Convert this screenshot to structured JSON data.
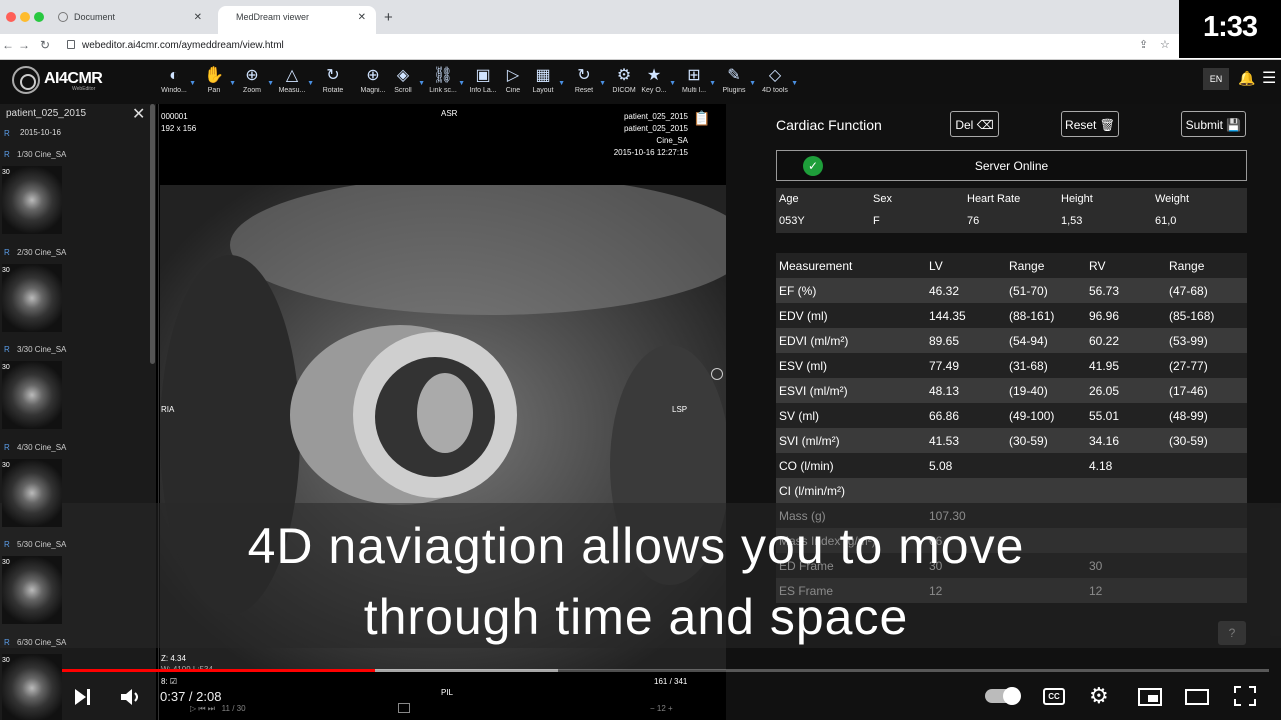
{
  "browser": {
    "tabs": [
      {
        "label": "Document"
      },
      {
        "label": "MedDream viewer"
      }
    ],
    "url": "webeditor.ai4cmr.com/aymeddream/view.html"
  },
  "video_time_overlay": "1:33",
  "app": {
    "brand": "AI4CMR",
    "brand_sub": "WebEditor",
    "tools": [
      {
        "label": "Windo...",
        "icon": "window-level-icon"
      },
      {
        "label": "Pan",
        "icon": "pan-icon"
      },
      {
        "label": "Zoom",
        "icon": "zoom-icon"
      },
      {
        "label": "Measu...",
        "icon": "measure-icon"
      },
      {
        "label": "Rotate",
        "icon": "rotate-icon"
      },
      {
        "label": "Magni...",
        "icon": "magnifier-icon"
      },
      {
        "label": "Scroll",
        "icon": "scroll-icon"
      },
      {
        "label": "Link sc...",
        "icon": "link-scroll-icon"
      },
      {
        "label": "Info La...",
        "icon": "info-layer-icon"
      },
      {
        "label": "Cine",
        "icon": "cine-play-icon"
      },
      {
        "label": "Layout",
        "icon": "layout-grid-icon"
      },
      {
        "label": "Reset",
        "icon": "reset-icon"
      },
      {
        "label": "DICOM",
        "icon": "dicom-icon"
      },
      {
        "label": "Key O...",
        "icon": "key-object-star-icon"
      },
      {
        "label": "Multi l...",
        "icon": "multi-layout-icon"
      },
      {
        "label": "Plugins",
        "icon": "plugins-icon"
      },
      {
        "label": "4D tools",
        "icon": "4d-tools-icon"
      }
    ],
    "lang": "EN"
  },
  "left_panel": {
    "patient": "patient_025_2015",
    "date": "2015-10-16",
    "badge": "R",
    "series": [
      {
        "label": "1/30 Cine_SA",
        "count": "30"
      },
      {
        "label": "2/30 Cine_SA",
        "count": "30"
      },
      {
        "label": "3/30 Cine_SA",
        "count": "30"
      },
      {
        "label": "4/30 Cine_SA",
        "count": "30"
      },
      {
        "label": "5/30 Cine_SA",
        "count": "30"
      },
      {
        "label": "6/30 Cine_SA",
        "count": "30"
      }
    ]
  },
  "viewer": {
    "top_left": [
      "000001",
      "192 x 156"
    ],
    "top_right": [
      "patient_025_2015",
      "patient_025_2015",
      "Cine_SA",
      "2015-10-16 12:27:15"
    ],
    "orient_top": "ASR",
    "orient_left": "RIA",
    "orient_right": "LSP",
    "orient_bottom": "PIL",
    "zoom": "Z: 4.34",
    "wl": "W: 4109 L:534",
    "slice": "161 / 341",
    "frame_ctrl": "11 / 30",
    "frame_num": "12",
    "slice_num_label": "8:"
  },
  "cardiac": {
    "title": "Cardiac Function",
    "buttons": {
      "del": "Del",
      "reset": "Reset",
      "submit": "Submit"
    },
    "server": "Server Online",
    "demographics": {
      "headers": [
        "Age",
        "Sex",
        "Heart Rate",
        "Height",
        "Weight"
      ],
      "values": [
        "053Y",
        "F",
        "76",
        "1,53",
        "61,0"
      ]
    },
    "table": {
      "headers": [
        "Measurement",
        "LV",
        "Range",
        "RV",
        "Range"
      ],
      "rows": [
        [
          "EF (%)",
          "46.32",
          "(51-70)",
          "56.73",
          "(47-68)"
        ],
        [
          "EDV (ml)",
          "144.35",
          "(88-161)",
          "96.96",
          "(85-168)"
        ],
        [
          "EDVI (ml/m²)",
          "89.65",
          "(54-94)",
          "60.22",
          "(53-99)"
        ],
        [
          "ESV (ml)",
          "77.49",
          "(31-68)",
          "41.95",
          "(27-77)"
        ],
        [
          "ESVI (ml/m²)",
          "48.13",
          "(19-40)",
          "26.05",
          "(17-46)"
        ],
        [
          "SV (ml)",
          "66.86",
          "(49-100)",
          "55.01",
          "(48-99)"
        ],
        [
          "SVI (ml/m²)",
          "41.53",
          "(30-59)",
          "34.16",
          "(30-59)"
        ],
        [
          "CO (l/min)",
          "5.08",
          "",
          "4.18",
          ""
        ],
        [
          "CI (l/min/m²)",
          "",
          "",
          "",
          ""
        ],
        [
          "Mass (g)",
          "107.30",
          "",
          "",
          ""
        ],
        [
          "Mass Index (g/m²)",
          "66",
          "",
          "",
          ""
        ],
        [
          "ED Frame",
          "30",
          "",
          "30",
          ""
        ],
        [
          "ES Frame",
          "12",
          "",
          "12",
          ""
        ]
      ]
    },
    "help": "?"
  },
  "subtitle": {
    "line1": "4D naviagtion allows you to move",
    "line2": "through time and space"
  },
  "video": {
    "time": "0:37 / 2:08",
    "progress_fraction": 0.289,
    "buffered_fraction": 0.434,
    "cc": "CC"
  }
}
